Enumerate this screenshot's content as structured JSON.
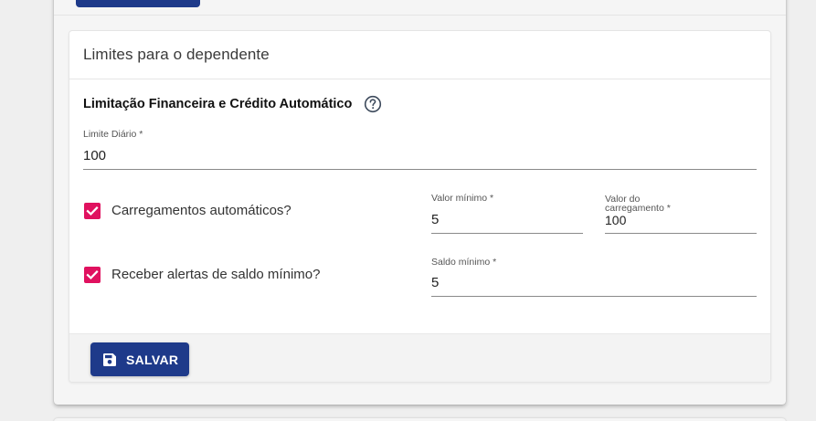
{
  "card": {
    "title": "Limites para o dependente",
    "section_title": "Limitação Financeira e Crédito Automático",
    "help_icon": "help-circle-icon"
  },
  "fields": {
    "limite_diario": {
      "label": "Limite Diário *",
      "value": "100"
    },
    "valor_minimo": {
      "label": "Valor mínimo *",
      "value": "5"
    },
    "valor_carregamento": {
      "label_line1": "Valor do",
      "label_line2": "carregamento *",
      "value": "100"
    },
    "saldo_minimo": {
      "label": "Saldo mínimo *",
      "value": "5"
    }
  },
  "checkboxes": {
    "carregamentos": {
      "label": "Carregamentos automáticos?",
      "checked": true
    },
    "alertas": {
      "label": "Receber alertas de saldo mínimo?",
      "checked": true
    }
  },
  "footer": {
    "save_label": "SALVAR",
    "save_icon": "floppy-disk-icon"
  },
  "colors": {
    "primary": "#1e3a8a",
    "checkbox": "#e0115f"
  }
}
